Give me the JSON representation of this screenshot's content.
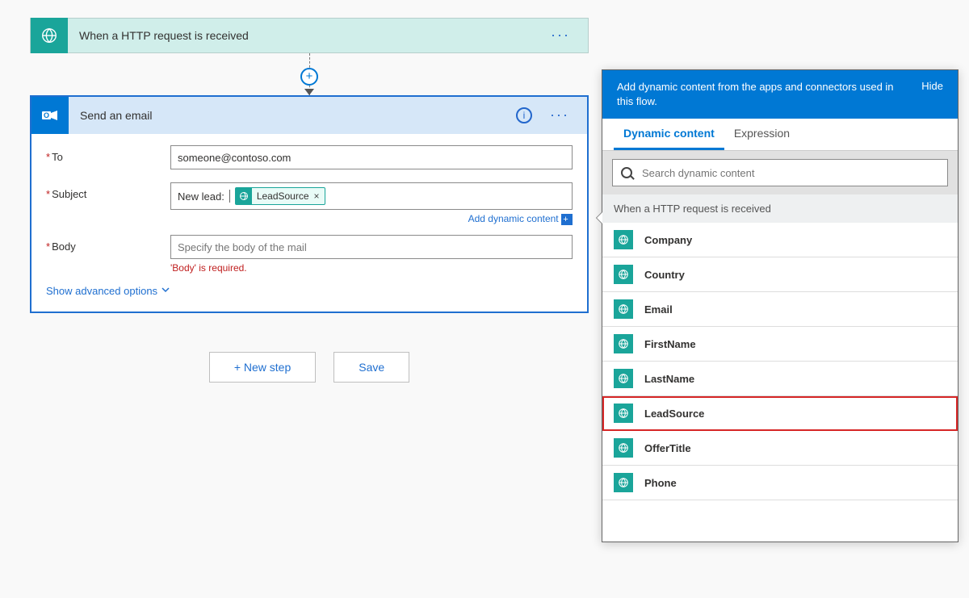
{
  "trigger": {
    "title": "When a HTTP request is received"
  },
  "action": {
    "title": "Send an email",
    "fields": {
      "to_label": "To",
      "to_value": "someone@contoso.com",
      "subject_label": "Subject",
      "subject_prefix": "New lead:",
      "subject_token": "LeadSource",
      "body_label": "Body",
      "body_placeholder": "Specify the body of the mail",
      "body_validation": "'Body' is required.",
      "add_dc_link": "Add dynamic content",
      "advanced_link": "Show advanced options"
    }
  },
  "bottom": {
    "new_step": "+ New step",
    "save": "Save"
  },
  "flyout": {
    "header_text": "Add dynamic content from the apps and connectors used in this flow.",
    "hide_label": "Hide",
    "tabs": {
      "dynamic": "Dynamic content",
      "expression": "Expression"
    },
    "search_placeholder": "Search dynamic content",
    "group_header": "When a HTTP request is received",
    "items": [
      {
        "label": "Company",
        "highlight": false
      },
      {
        "label": "Country",
        "highlight": false
      },
      {
        "label": "Email",
        "highlight": false
      },
      {
        "label": "FirstName",
        "highlight": false
      },
      {
        "label": "LastName",
        "highlight": false
      },
      {
        "label": "LeadSource",
        "highlight": true
      },
      {
        "label": "OfferTitle",
        "highlight": false
      },
      {
        "label": "Phone",
        "highlight": false
      }
    ]
  }
}
